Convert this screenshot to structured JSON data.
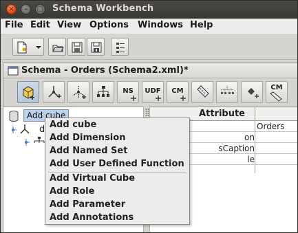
{
  "window": {
    "title": "Schema Workbench",
    "close_glyph": "×",
    "minimize_glyph": "–",
    "maximize_glyph": "□"
  },
  "menubar": {
    "items": [
      "File",
      "Edit",
      "View",
      "Options",
      "Windows",
      "Help"
    ],
    "mnemonics": [
      "F",
      "E",
      "V",
      "O",
      "W",
      "H"
    ]
  },
  "main_toolbar": {
    "buttons": [
      {
        "name": "new-document-icon"
      },
      {
        "name": "open-folder-icon"
      },
      {
        "name": "save-disk-icon"
      },
      {
        "name": "save-as-disk-icon"
      },
      {
        "name": "preferences-icon"
      }
    ]
  },
  "schema_window": {
    "title": "Schema - Orders (Schema2.xml)*",
    "toolbar": [
      {
        "name": "add-cube-icon",
        "label": ""
      },
      {
        "name": "add-dimension-icon",
        "label": ""
      },
      {
        "name": "add-dimension-usage-icon",
        "label": ""
      },
      {
        "name": "add-hierarchy-icon",
        "label": ""
      },
      {
        "name": "add-named-set-icon",
        "label": "NS"
      },
      {
        "name": "add-udf-icon",
        "label": "UDF"
      },
      {
        "name": "add-calculated-member-icon",
        "label": "CM"
      },
      {
        "name": "add-measure-icon",
        "label": ""
      },
      {
        "name": "add-level-icon",
        "label": ""
      },
      {
        "name": "add-property-icon",
        "label": ""
      },
      {
        "name": "add-calculated-measure-icon",
        "label": "CM"
      }
    ]
  },
  "tree": {
    "tooltip": "Add cube",
    "node_label": "d"
  },
  "attributes_table": {
    "header": "Attribute",
    "rows": [
      {
        "attribute": "",
        "value": "Orders"
      },
      {
        "attribute": "on",
        "value": ""
      },
      {
        "attribute": "sCaption",
        "value": ""
      },
      {
        "attribute": "le",
        "value": ""
      }
    ]
  },
  "context_menu": {
    "group1": [
      "Add cube",
      "Add Dimension",
      "Add Named Set",
      "Add User Defined Function"
    ],
    "group2": [
      "Add Virtual Cube",
      "Add Role",
      "Add Parameter",
      "Add Annotations"
    ]
  },
  "colors": {
    "titlebar": "#3a3935",
    "close_button": "#df4a16",
    "tooltip_bg": "#bcd0ea",
    "menu_bg": "#edeceb"
  }
}
